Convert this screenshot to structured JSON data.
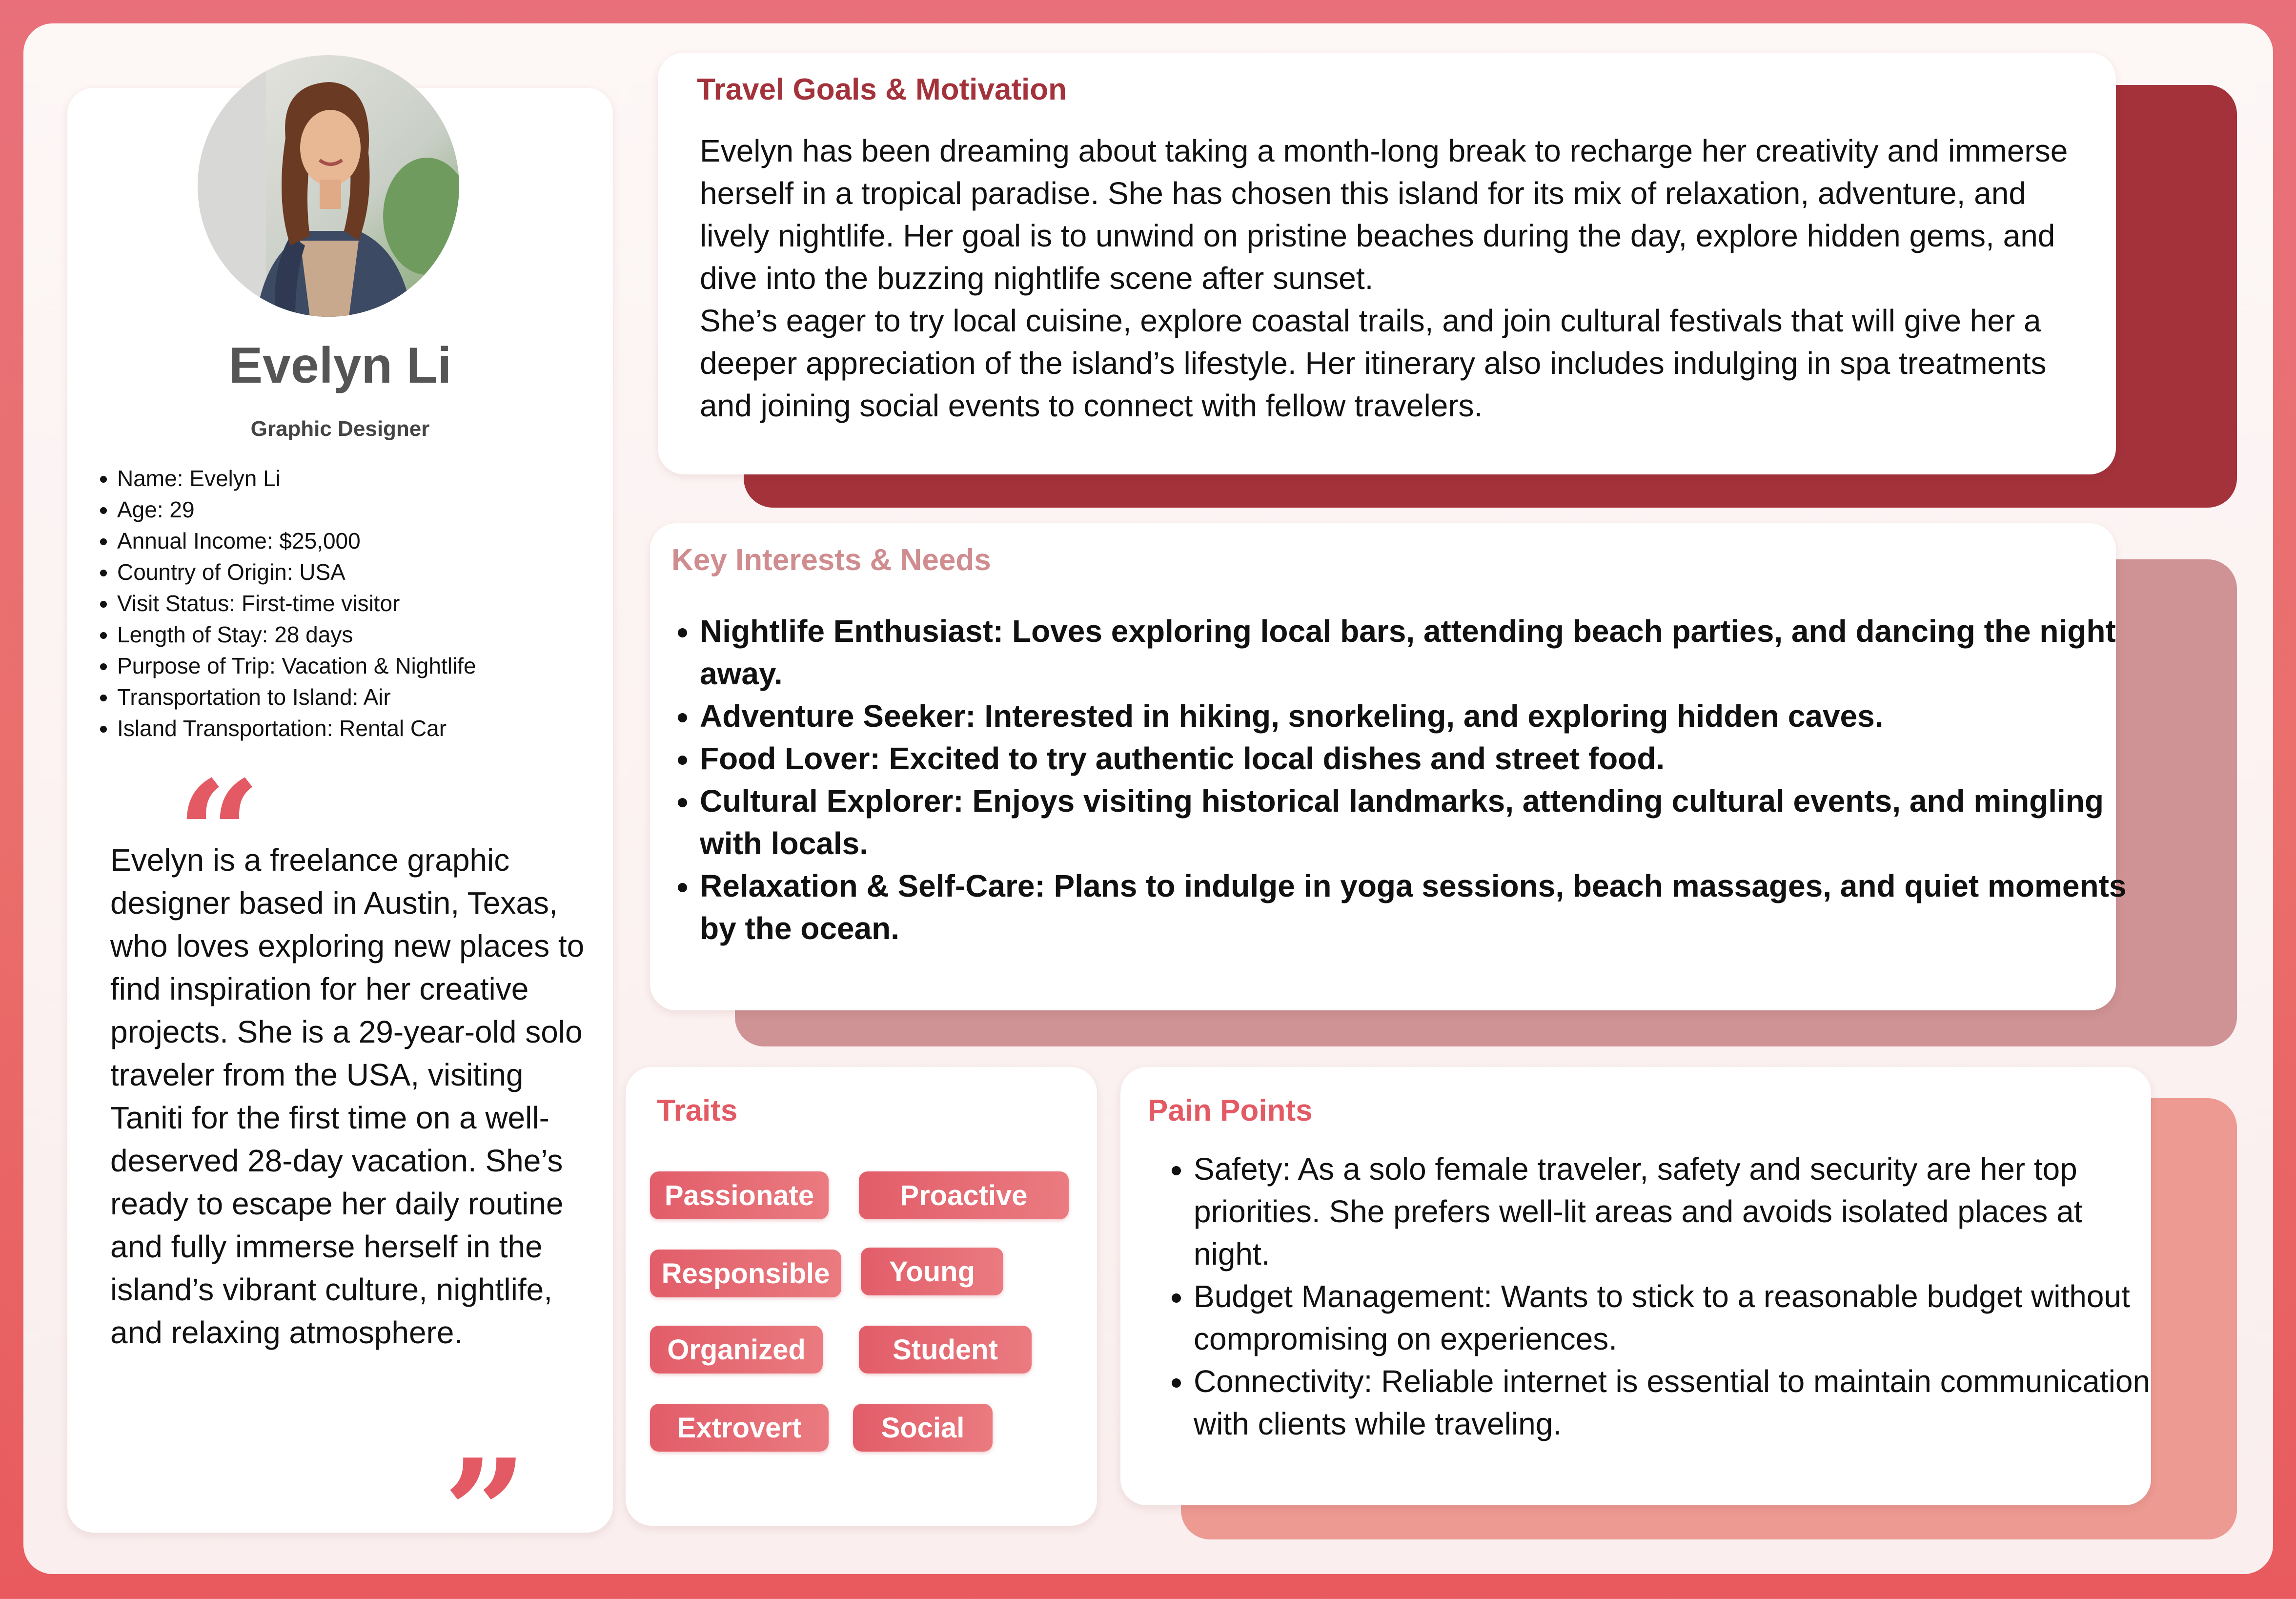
{
  "profile": {
    "name": "Evelyn Li",
    "role": "Graphic Designer",
    "facts": [
      "Name: Evelyn Li",
      "Age: 29",
      "Annual Income: $25,000",
      "Country of Origin: USA",
      "Visit Status: First-time visitor",
      "Length of Stay: 28 days",
      "Purpose of Trip: Vacation & Nightlife",
      "Transportation to Island: Air",
      "Island Transportation: Rental Car"
    ],
    "quote_open": "“",
    "quote_close": "”",
    "bio": "Evelyn is a freelance graphic designer based in Austin, Texas, who loves exploring new places to find inspiration for her creative projects. She is a 29-year-old solo traveler from the USA, visiting Taniti for the first time on a well-deserved 28-day vacation. She’s ready to escape her daily routine and fully immerse herself in the island’s vibrant culture, nightlife, and relaxing atmosphere."
  },
  "goals": {
    "title": "Travel Goals & Motivation",
    "paragraph1": "Evelyn has been dreaming about taking a month-long break to recharge her creativity and immerse herself in a tropical paradise. She has chosen this island for its mix of relaxation, adventure, and lively nightlife. Her goal is to unwind on pristine beaches during the day, explore hidden gems, and dive into the buzzing nightlife scene after sunset.",
    "paragraph2": "She’s eager to try local cuisine, explore coastal trails, and join cultural festivals that will give her a deeper appreciation of the island’s lifestyle. Her itinerary also includes indulging in spa treatments and joining social events to connect with fellow travelers."
  },
  "interests": {
    "title": "Key Interests & Needs",
    "items": [
      "Nightlife Enthusiast: Loves exploring local bars, attending beach parties, and dancing the night away.",
      "Adventure Seeker: Interested in hiking, snorkeling, and exploring hidden caves.",
      "Food Lover: Excited to try authentic local dishes and street food.",
      "Cultural Explorer: Enjoys visiting historical landmarks, attending cultural events, and mingling with locals.",
      "Relaxation & Self-Care: Plans to indulge in yoga sessions, beach massages, and quiet moments by the ocean."
    ]
  },
  "traits": {
    "title": "Traits",
    "items": [
      "Passionate",
      "Proactive",
      "Responsible",
      "Young",
      "Organized",
      "Student",
      "Extrovert",
      "Social"
    ]
  },
  "pain_points": {
    "title": "Pain Points",
    "items": [
      "Safety: As a solo female traveler, safety and security are her top priorities. She prefers well-lit areas and avoids isolated places at night.",
      "Budget Management: Wants to stick to a reasonable budget without compromising on experiences.",
      "Connectivity: Reliable internet is essential to maintain communication with clients while traveling."
    ]
  },
  "colors": {
    "dark_red": "#a3323b",
    "dusty_rose": "#cf9395",
    "salmon": "#ec9a92",
    "accent": "#e35a64"
  }
}
